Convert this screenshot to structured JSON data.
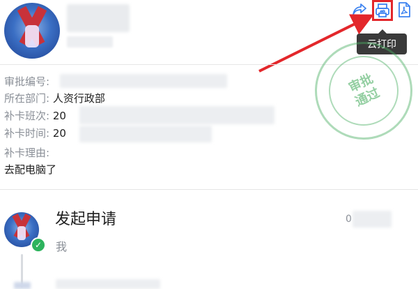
{
  "header": {
    "tooltip_label": "云打印",
    "icons": [
      "share-icon",
      "print-icon",
      "pdf-icon"
    ]
  },
  "stamp": {
    "line1": "审批",
    "line2": "通过"
  },
  "fields": [
    {
      "label": "审批编号:",
      "value": ""
    },
    {
      "label": "所在部门:",
      "value": "人资行政部"
    },
    {
      "label": "补卡班次:",
      "value": "20"
    },
    {
      "label": "补卡时间:",
      "value": "20"
    },
    {
      "label": "补卡理由:",
      "value": ""
    }
  ],
  "reason_text": "去配电脑了",
  "timeline": {
    "step_title": "发起申请",
    "step_sub": "我",
    "time_prefix": "0"
  },
  "colors": {
    "accent": "#3d83f0",
    "highlight_red": "#e3272b",
    "stamp_green": "#4caf64",
    "success": "#2db35d"
  }
}
